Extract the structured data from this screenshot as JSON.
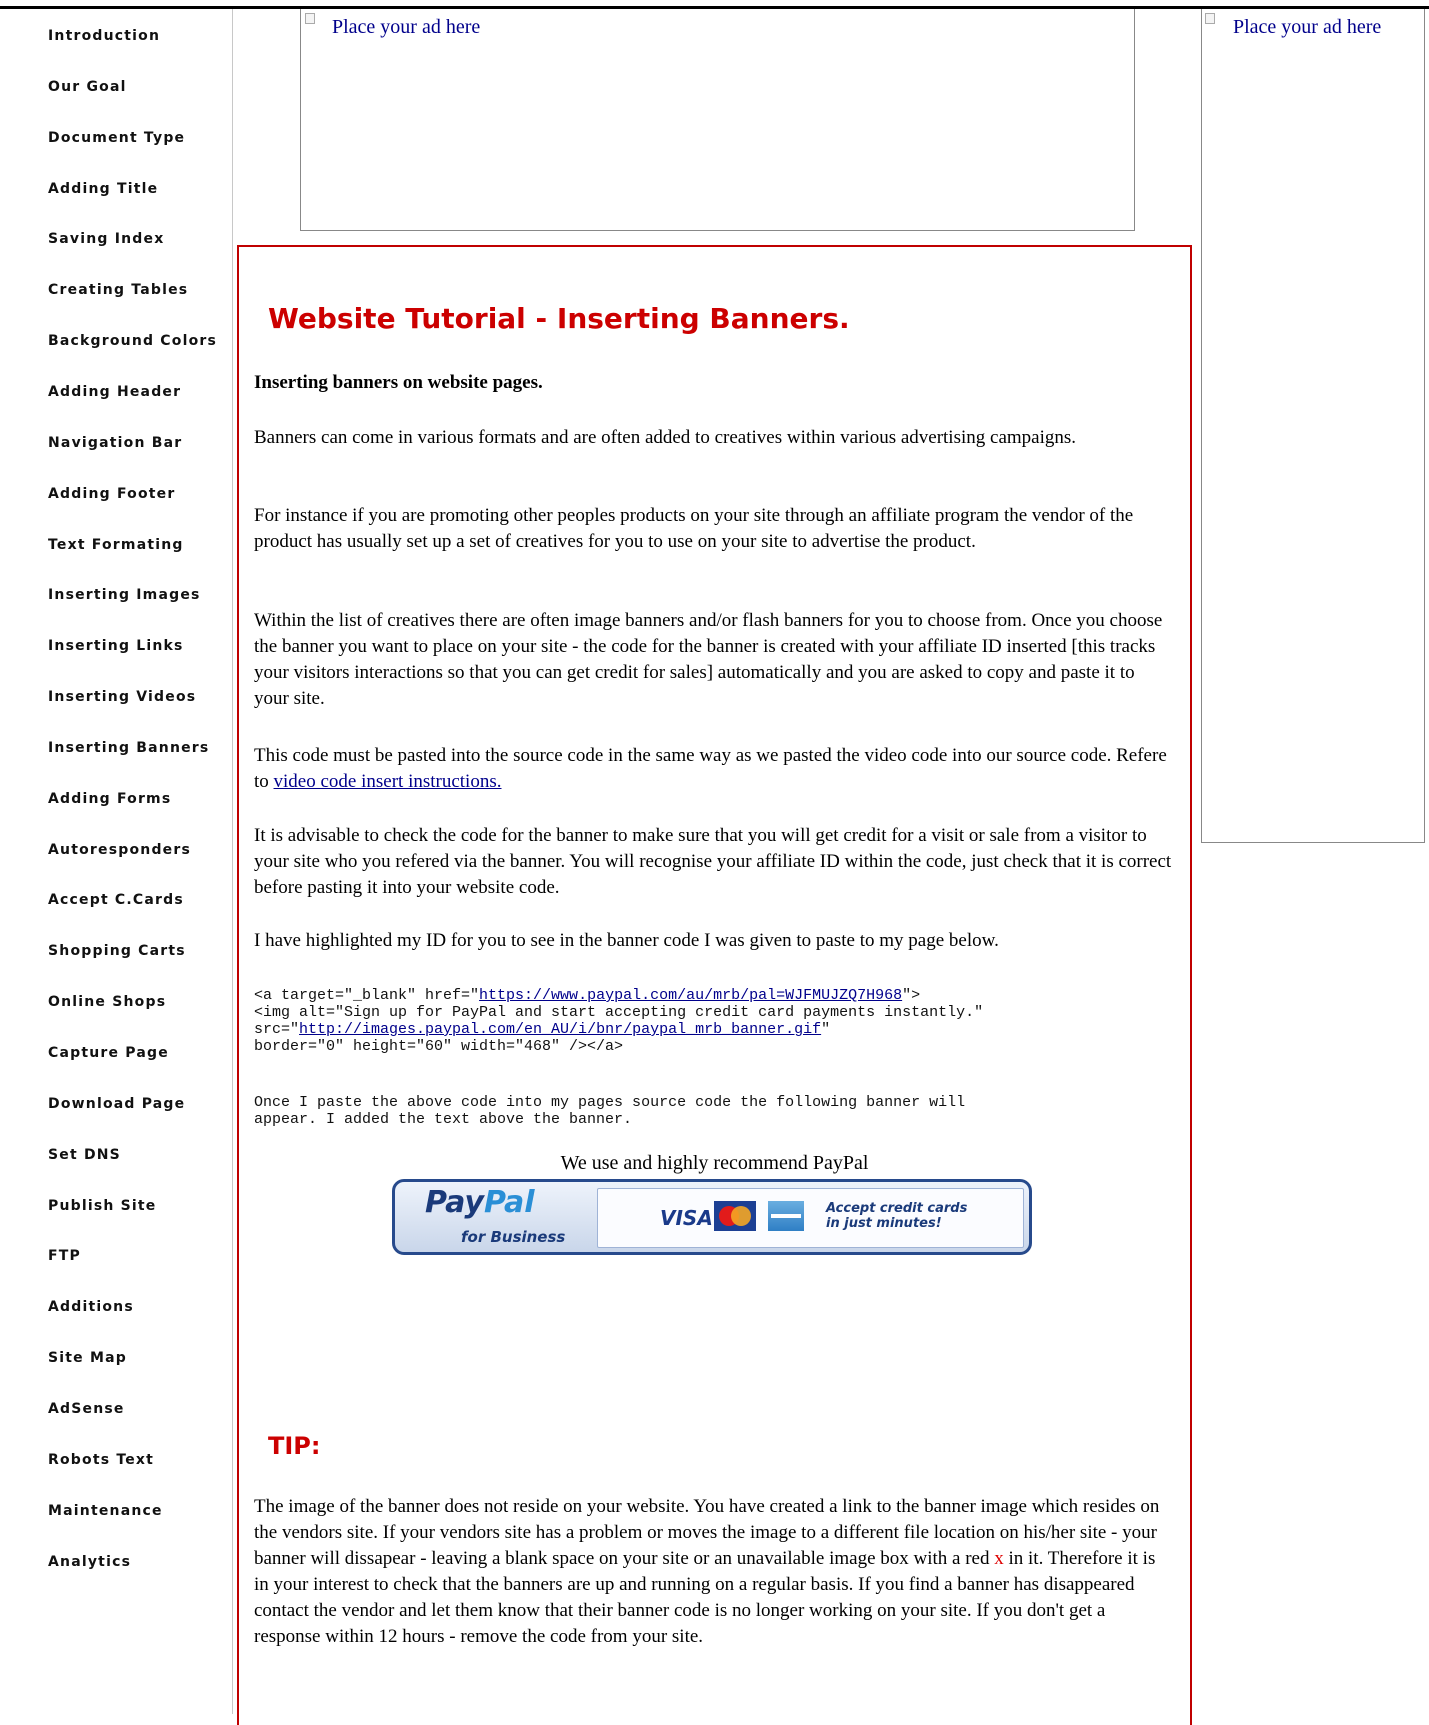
{
  "sidebar": {
    "items": [
      "Introduction",
      "Our Goal",
      "Document Type",
      "Adding Title",
      "Saving Index",
      "Creating Tables",
      "Background Colors",
      "Adding Header",
      "Navigation Bar",
      "Adding Footer",
      "Text Formating",
      "Inserting Images",
      "Inserting Links",
      "Inserting Videos",
      "Inserting Banners",
      "Adding Forms",
      "Autoresponders",
      "Accept C.Cards",
      "Shopping Carts",
      "Online Shops",
      "Capture Page",
      "Download Page",
      "Set DNS",
      "Publish Site",
      "FTP",
      "Additions",
      "Site Map",
      "AdSense",
      "Robots Text",
      "Maintenance",
      "Analytics"
    ]
  },
  "ads": {
    "top_ad_label": "Place your ad here",
    "side_ad_label": "Place your ad here",
    "broken_image_icon": "broken-image-icon"
  },
  "content": {
    "title": "Website Tutorial - Inserting Banners.",
    "subheading": "Inserting banners on website pages.",
    "para1": "Banners can come in various formats and are often added to creatives within various advertising campaigns.",
    "para2": "For instance if you are promoting other peoples products on your site through an affiliate program the vendor of the product has usually set up a set of creatives for you to use on your site to advertise the product.",
    "para3": "Within the list of creatives there are often image banners and/or flash banners for you to choose from. Once you choose the banner you want to place on your site - the code for the banner is created with your affiliate ID inserted [this tracks your visitors interactions so that you can get credit for sales] automatically and you are asked to copy and paste it to your site.",
    "para4_text": "This code must be pasted into the source code in the same way as we pasted the video code into our source code. Refere to ",
    "para4_link": "video code insert instructions.",
    "para5": "It is advisable to check the code for the banner to make sure that you will get credit for a visit or sale from a visitor to your site who you refered via the banner. You will recognise your affiliate ID within the code, just check that it is correct before pasting it into your website code.",
    "para6": "I have highlighted my ID for you to see in the banner code I was given to paste to my page below.",
    "code": {
      "line1_pre": "<a target=\"_blank\" href=\"",
      "line1_link": "https://www.paypal.com/au/mrb/pal=WJFMUJZQ7H968",
      "line1_post": "\">",
      "line2": "<img alt=\"Sign up for PayPal and start accepting credit card payments instantly.\"",
      "line3_pre": "src=\"",
      "line3_link": "http://images.paypal.com/en_AU/i/bnr/paypal_mrb_banner.gif",
      "line3_post": "\"",
      "line4": "border=\"0\" height=\"60\" width=\"468\" /></a>"
    },
    "code_note": "Once I paste the above code into my pages source code the following banner will\nappear. I added the text above the banner.",
    "recommend": "We use and highly recommend PayPal",
    "banner": {
      "logo_pay": "Pay",
      "logo_pal": "Pal",
      "sub": "for Business",
      "visa": "VISA",
      "accept_line1": "Accept credit cards",
      "accept_line2": "in just minutes!"
    },
    "tip_heading": "TIP:",
    "tip_pre": "The image of the banner does not reside on your website. You have created a link to the banner image which resides on the vendors site. If your vendors site has a problem or moves the image to a different file location on his/her site - your banner will dissapear - leaving a blank space on your site or an unavailable image box with a red ",
    "tip_x": "x",
    "tip_post": " in it. Therefore it is in your interest to check that the banners are up and running on a regular basis. If you find a banner has disappeared  contact the vendor and let them know that their banner code is no longer working on your site. If you don't get a response within 12 hours - remove the code from your site."
  },
  "colors": {
    "heading_red": "#cc0000",
    "link_blue": "#00008b",
    "border_red": "#c00000"
  }
}
